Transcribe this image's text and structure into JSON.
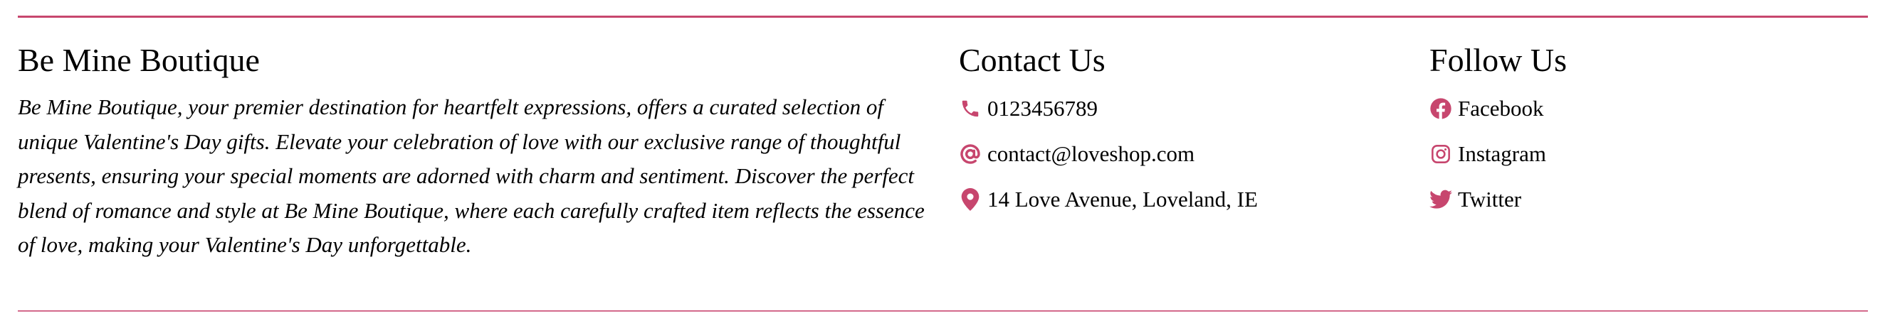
{
  "colors": {
    "accent": "#c7466e",
    "text": "#000000",
    "background": "#ffffff"
  },
  "about": {
    "heading": "Be Mine Boutique",
    "text": "Be Mine Boutique, your premier destination for heartfelt expressions, offers a curated selection of unique Valentine's Day gifts. Elevate your celebration of love with our exclusive range of thoughtful presents, ensuring your special moments are adorned with charm and sentiment. Discover the perfect blend of romance and style at Be Mine Boutique, where each carefully crafted item reflects the essence of love, making your Valentine's Day unforgettable."
  },
  "contact": {
    "heading": "Contact Us",
    "items": [
      {
        "icon": "phone-icon",
        "text": "0123456789"
      },
      {
        "icon": "at-icon",
        "text": "contact@loveshop.com"
      },
      {
        "icon": "location-pin-icon",
        "text": "14 Love Avenue, Loveland, IE"
      }
    ]
  },
  "follow": {
    "heading": "Follow Us",
    "items": [
      {
        "icon": "facebook-icon",
        "text": "Facebook"
      },
      {
        "icon": "instagram-icon",
        "text": "Instagram"
      },
      {
        "icon": "twitter-icon",
        "text": "Twitter"
      }
    ]
  }
}
